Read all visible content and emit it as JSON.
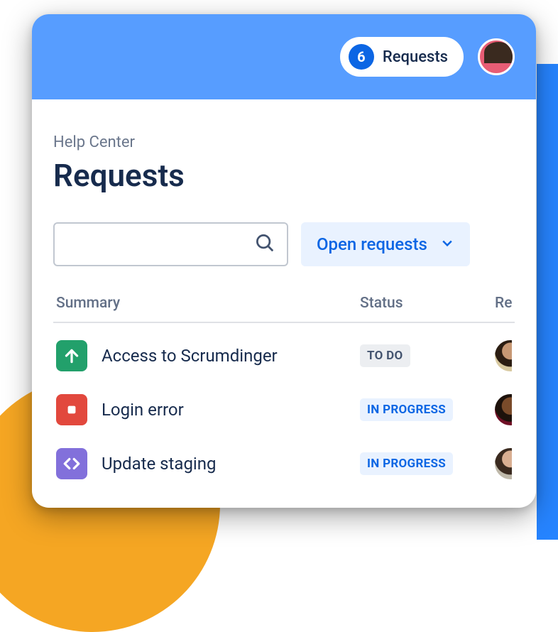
{
  "header": {
    "requests_count": "6",
    "requests_label": "Requests"
  },
  "breadcrumb": "Help Center",
  "page_title": "Requests",
  "search": {
    "placeholder": ""
  },
  "filter": {
    "label": "Open requests"
  },
  "columns": {
    "summary": "Summary",
    "status": "Status",
    "requester": "Requester"
  },
  "status_labels": {
    "todo": "TO DO",
    "in_progress": "IN PROGRESS"
  },
  "rows": [
    {
      "icon": "arrow-up-icon",
      "icon_color": "green",
      "summary": "Access to Scrumdinger",
      "status_key": "todo",
      "avatar": "ma1"
    },
    {
      "icon": "dot-icon",
      "icon_color": "red",
      "summary": "Login error",
      "status_key": "in_progress",
      "avatar": "ma2"
    },
    {
      "icon": "code-icon",
      "icon_color": "purple",
      "summary": "Update staging",
      "status_key": "in_progress",
      "avatar": "ma3"
    }
  ]
}
